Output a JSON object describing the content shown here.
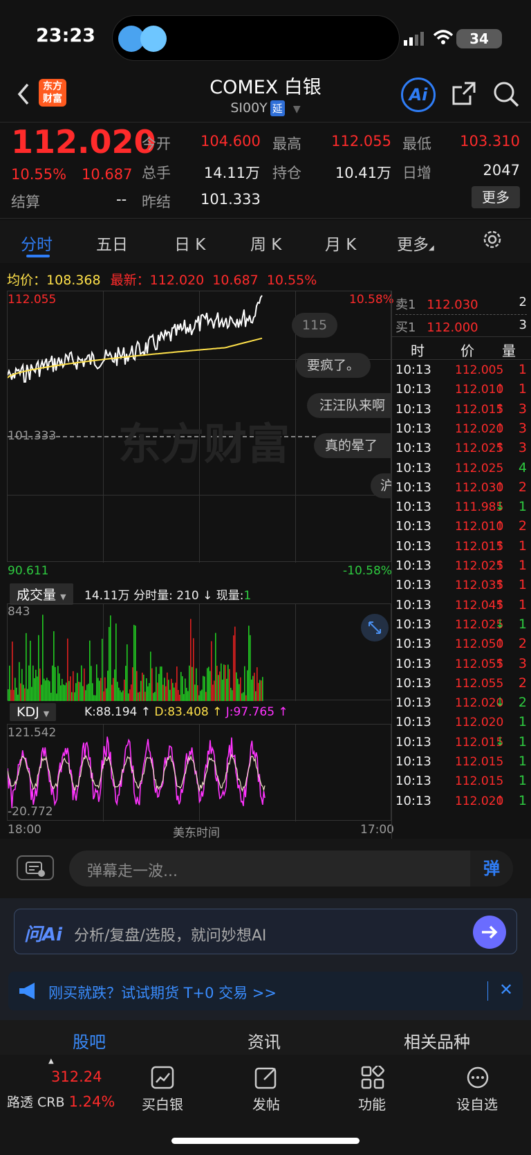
{
  "status_bar": {
    "time": "23:23",
    "battery": "34"
  },
  "header": {
    "logo_text": "东方财富",
    "title": "COMEX 白银",
    "symbol": "SI00Y",
    "tag": "延",
    "ai_label": "Ai"
  },
  "quote": {
    "price": "112.020",
    "change_pct": "10.55%",
    "change": "10.687",
    "settle_label": "结算",
    "settle_value": "--",
    "fields": [
      {
        "label": "今开",
        "value": "104.600"
      },
      {
        "label": "最高",
        "value": "112.055"
      },
      {
        "label": "最低",
        "value": "103.310"
      },
      {
        "label": "总手",
        "value": "14.11万"
      },
      {
        "label": "持仓",
        "value": "10.41万"
      },
      {
        "label": "日增",
        "value": "2047"
      },
      {
        "label": "昨结",
        "value": "101.333"
      }
    ],
    "more_button": "更多"
  },
  "tabs": [
    "分时",
    "五日",
    "日 K",
    "周 K",
    "月 K",
    "更多"
  ],
  "chart": {
    "avg_label": "均价：",
    "avg_value": "108.368",
    "latest_label": "最新：",
    "latest_value": "112.020",
    "latest_change": "10.687",
    "latest_pct": "10.55%",
    "top_price": "112.055",
    "top_pct": "10.58%",
    "mid_price": "101.333",
    "bottom_price": "90.611",
    "bottom_pct": "-10.58%",
    "watermark": "东方财富",
    "volume_selector": "成交量",
    "volume_info_total": "14.11万",
    "volume_info_label": "分时量:",
    "volume_info_value": "210",
    "volume_info_now_label": "现量:",
    "volume_info_now": "1",
    "volume_max": "843",
    "kdj_selector": "KDJ",
    "kdj_k": "K:88.194",
    "kdj_d": "D:83.408",
    "kdj_j": "J:97.765",
    "kdj_max": "121.542",
    "kdj_min": "-20.772",
    "time_start": "18:00",
    "time_mid": "美东时间",
    "time_end": "17:00"
  },
  "danmaku": [
    "115",
    "要疯了。",
    "汪汪队来啊",
    "真的晕了",
    "沪"
  ],
  "order_book": {
    "ask_label": "卖1",
    "ask_price": "112.030",
    "ask_qty": "2",
    "bid_label": "买1",
    "bid_price": "112.000",
    "bid_qty": "3",
    "headers": [
      "时",
      "价",
      "量"
    ],
    "trades": [
      {
        "time": "10:13",
        "price": "112.005",
        "arrow": "",
        "qty": "1",
        "qty_color": "red"
      },
      {
        "time": "10:13",
        "price": "112.010",
        "arrow": "↑",
        "qty": "1",
        "qty_color": "red"
      },
      {
        "time": "10:13",
        "price": "112.015",
        "arrow": "↑",
        "qty": "3",
        "qty_color": "red"
      },
      {
        "time": "10:13",
        "price": "112.020",
        "arrow": "↑",
        "qty": "3",
        "qty_color": "red"
      },
      {
        "time": "10:13",
        "price": "112.025",
        "arrow": "↑",
        "qty": "3",
        "qty_color": "red"
      },
      {
        "time": "10:13",
        "price": "112.025",
        "arrow": "",
        "qty": "4",
        "qty_color": "green"
      },
      {
        "time": "10:13",
        "price": "112.030",
        "arrow": "↑",
        "qty": "2",
        "qty_color": "red"
      },
      {
        "time": "10:13",
        "price": "111.985",
        "arrow": "↓",
        "qty": "1",
        "qty_color": "green"
      },
      {
        "time": "10:13",
        "price": "112.010",
        "arrow": "↑",
        "qty": "2",
        "qty_color": "red"
      },
      {
        "time": "10:13",
        "price": "112.015",
        "arrow": "↑",
        "qty": "1",
        "qty_color": "red"
      },
      {
        "time": "10:13",
        "price": "112.025",
        "arrow": "↑",
        "qty": "1",
        "qty_color": "red"
      },
      {
        "time": "10:13",
        "price": "112.035",
        "arrow": "↑",
        "qty": "1",
        "qty_color": "red"
      },
      {
        "time": "10:13",
        "price": "112.045",
        "arrow": "↑",
        "qty": "1",
        "qty_color": "red"
      },
      {
        "time": "10:13",
        "price": "112.025",
        "arrow": "↓",
        "qty": "1",
        "qty_color": "green"
      },
      {
        "time": "10:13",
        "price": "112.050",
        "arrow": "↑",
        "qty": "2",
        "qty_color": "red"
      },
      {
        "time": "10:13",
        "price": "112.055",
        "arrow": "↑",
        "qty": "3",
        "qty_color": "red"
      },
      {
        "time": "10:13",
        "price": "112.055",
        "arrow": "",
        "qty": "2",
        "qty_color": "red"
      },
      {
        "time": "10:13",
        "price": "112.020",
        "arrow": "↓",
        "qty": "2",
        "qty_color": "green"
      },
      {
        "time": "10:13",
        "price": "112.020",
        "arrow": "",
        "qty": "1",
        "qty_color": "green"
      },
      {
        "time": "10:13",
        "price": "112.015",
        "arrow": "↓",
        "qty": "1",
        "qty_color": "green"
      },
      {
        "time": "10:13",
        "price": "112.015",
        "arrow": "",
        "qty": "1",
        "qty_color": "green"
      },
      {
        "time": "10:13",
        "price": "112.015",
        "arrow": "",
        "qty": "1",
        "qty_color": "green"
      },
      {
        "time": "10:13",
        "price": "112.020",
        "arrow": "↑",
        "qty": "1",
        "qty_color": "green"
      }
    ]
  },
  "comment_bar": {
    "placeholder": "弹幕走一波...",
    "dan_label": "弹"
  },
  "ai_bar": {
    "brand": "问Ai",
    "placeholder": "分析/复盘/选股，就问妙想AI"
  },
  "banner": {
    "text": "刚买就跌？试试期货 T+0 交易 >>"
  },
  "sub_tabs": [
    "股吧",
    "资讯",
    "相关品种"
  ],
  "bottom_bar": {
    "ticker_price": "312.24",
    "ticker_name": "路透 CRB",
    "ticker_pct": "1.24%",
    "items": [
      "买白银",
      "发帖",
      "功能",
      "设自选"
    ]
  },
  "colors": {
    "up": "#ff2b2b",
    "down": "#2ecc40",
    "accent": "#2f7df6",
    "avg": "#ffe14a",
    "kdj_j": "#ff33ff"
  }
}
